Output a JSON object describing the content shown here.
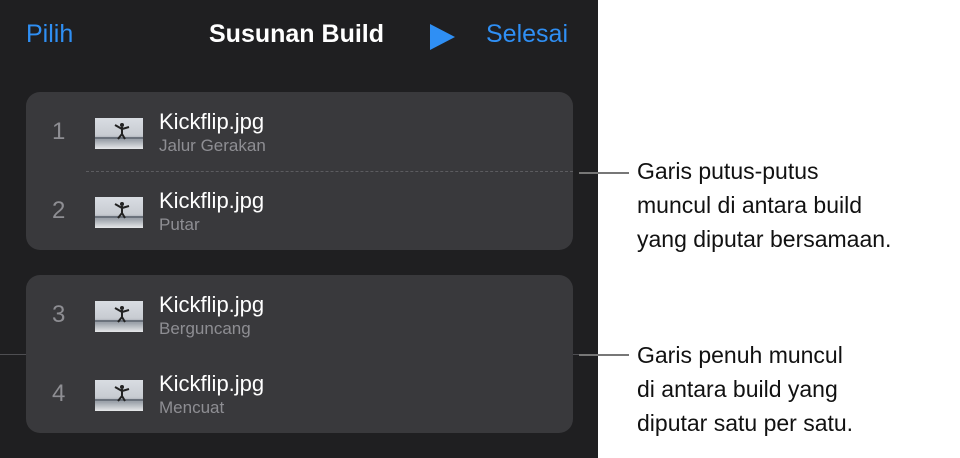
{
  "header": {
    "left_button": "Pilih",
    "title": "Susunan Build",
    "play_icon": "play-icon",
    "right_button": "Selesai",
    "accent_color": "#2f8ff4"
  },
  "builds": [
    {
      "number": "1",
      "name": "Kickflip.jpg",
      "effect": "Jalur Gerakan"
    },
    {
      "number": "2",
      "name": "Kickflip.jpg",
      "effect": "Putar"
    },
    {
      "number": "3",
      "name": "Kickflip.jpg",
      "effect": "Berguncang"
    },
    {
      "number": "4",
      "name": "Kickflip.jpg",
      "effect": "Mencuat"
    }
  ],
  "callouts": {
    "dashed": [
      "Garis putus-putus",
      "muncul di antara build",
      "yang diputar bersamaan."
    ],
    "solid": [
      "Garis penuh muncul",
      "di antara build yang",
      "diputar satu per satu."
    ]
  }
}
